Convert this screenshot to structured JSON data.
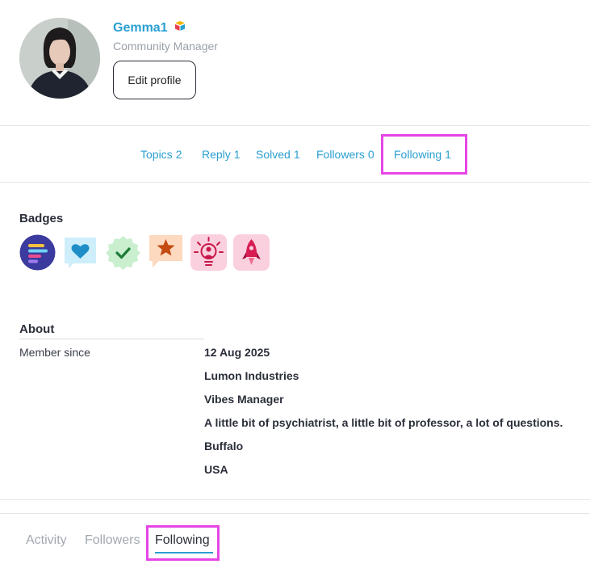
{
  "profile": {
    "username": "Gemma1",
    "role": "Community Manager",
    "edit_label": "Edit profile"
  },
  "stats": [
    {
      "label": "Topics",
      "count": "2"
    },
    {
      "label": "Reply",
      "count": "1"
    },
    {
      "label": "Solved",
      "count": "1"
    },
    {
      "label": "Followers",
      "count": "0"
    },
    {
      "label": "Following",
      "count": "1"
    }
  ],
  "badges": {
    "title": "Badges",
    "items": [
      "bars-badge-icon",
      "heart-chat-badge-icon",
      "check-seal-badge-icon",
      "star-chat-badge-icon",
      "lightbulb-badge-icon",
      "rocket-badge-icon"
    ]
  },
  "about": {
    "title": "About",
    "member_since_label": "Member since",
    "values": [
      "12 Aug 2025",
      "Lumon Industries",
      "Vibes Manager",
      "A little bit of psychiatrist, a little bit of professor, a lot of questions.",
      "Buffalo",
      "USA"
    ]
  },
  "tabs": [
    "Activity",
    "Followers",
    "Following"
  ],
  "colors": {
    "accent": "#2a9fd0",
    "highlight": "#e646e6",
    "muted": "#a3a8b0"
  }
}
